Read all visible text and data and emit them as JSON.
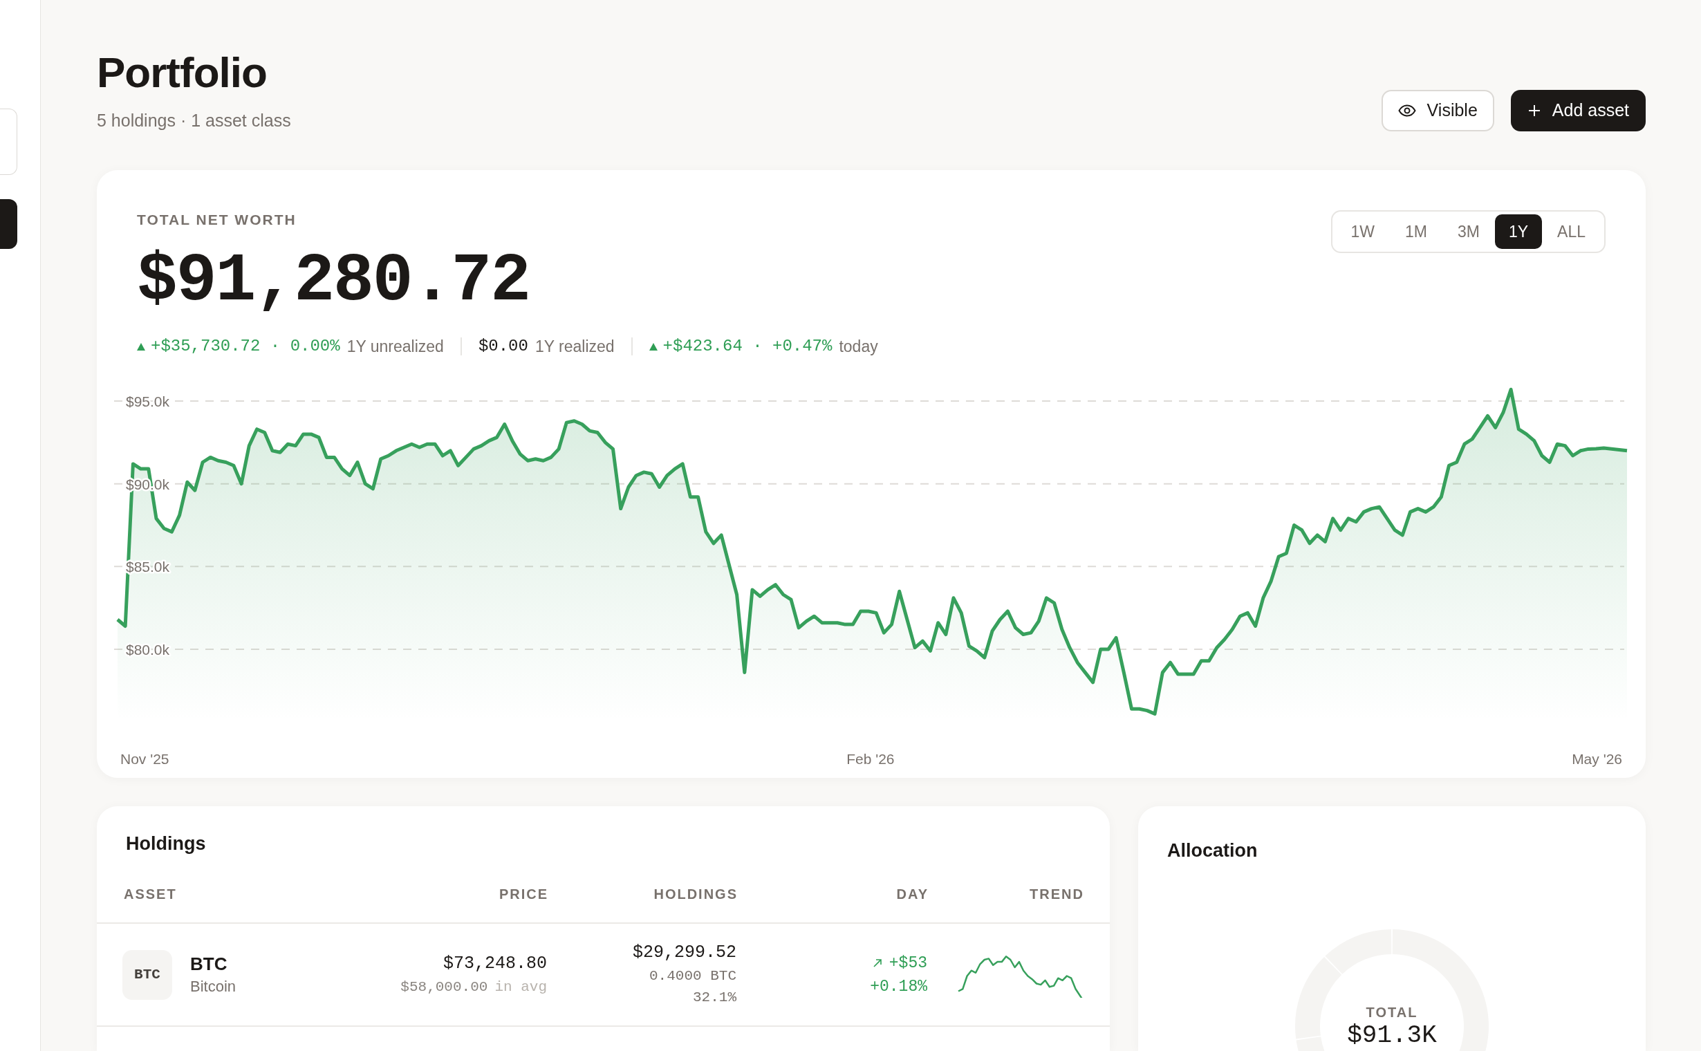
{
  "sidebar": {
    "items": [
      {
        "selected": false
      },
      {
        "selected": true
      }
    ]
  },
  "header": {
    "title": "Portfolio",
    "subtitle": "5 holdings · 1 asset class",
    "actions": [
      {
        "label": "Visible",
        "kind": "secondary"
      },
      {
        "label": "Add asset",
        "kind": "primary"
      }
    ]
  },
  "net_worth": {
    "label": "TOTAL NET WORTH",
    "value": "$91,280.72",
    "ranges": [
      {
        "label": "1W",
        "selected": false
      },
      {
        "label": "1M",
        "selected": false
      },
      {
        "label": "3M",
        "selected": false
      },
      {
        "label": "1Y",
        "selected": true
      },
      {
        "label": "ALL",
        "selected": false
      }
    ],
    "summary": [
      {
        "value": "+$35,730.72 · 0.00%",
        "label": "1Y unrealized",
        "color": "#2f9e55",
        "arrow": true
      },
      {
        "value": "$0.00",
        "label": "1Y realized",
        "color": "#1c1917",
        "arrow": false
      },
      {
        "value": "+$423.64 · +0.47%",
        "label": "today",
        "color": "#2f9e55",
        "arrow": true
      }
    ],
    "chart_data": {
      "type": "area",
      "ylim": [
        72.19,
        108.91
      ],
      "grid": true,
      "yticks": [
        {
          "value": 80,
          "label": "$80.0k"
        },
        {
          "value": 85,
          "label": "$85.0k"
        },
        {
          "value": 90,
          "label": "$90.0k"
        },
        {
          "value": 95,
          "label": "$95.0k"
        }
      ],
      "values": [
        81.8,
        81.4,
        91.2,
        90.9,
        90.9,
        87.9,
        87.3,
        87.1,
        88.1,
        90.1,
        89.6,
        91.3,
        91.6,
        91.4,
        91.3,
        91.1,
        90.0,
        92.3,
        93.3,
        93.1,
        92.0,
        91.9,
        92.4,
        92.3,
        93.0,
        93.0,
        92.8,
        91.6,
        91.6,
        90.9,
        90.5,
        91.3,
        90.0,
        89.7,
        91.5,
        91.7,
        92.0,
        92.2,
        92.4,
        92.2,
        92.4,
        92.4,
        91.7,
        92.0,
        91.1,
        91.6,
        92.1,
        92.3,
        92.6,
        92.8,
        93.6,
        92.6,
        91.8,
        91.4,
        91.5,
        91.4,
        91.6,
        92.1,
        93.7,
        93.8,
        93.6,
        93.2,
        93.1,
        92.5,
        92.1,
        88.5,
        89.8,
        90.5,
        90.7,
        90.6,
        89.8,
        90.5,
        90.9,
        91.2,
        89.2,
        89.2,
        87.1,
        86.4,
        86.9,
        85.1,
        83.3,
        78.6,
        83.6,
        83.2,
        83.6,
        83.9,
        83.3,
        83.0,
        81.3,
        81.7,
        82.0,
        81.6,
        81.6,
        81.6,
        81.5,
        81.5,
        82.3,
        82.3,
        82.2,
        81.0,
        81.5,
        83.5,
        81.8,
        80.1,
        80.5,
        79.9,
        81.6,
        80.9,
        83.1,
        82.2,
        80.2,
        79.9,
        79.5,
        81.1,
        81.8,
        82.3,
        81.3,
        80.9,
        81.0,
        81.7,
        83.1,
        82.8,
        81.2,
        80.1,
        79.2,
        78.6,
        78.0,
        80.0,
        80.0,
        80.7,
        78.6,
        76.4,
        76.4,
        76.3,
        76.1,
        78.6,
        79.2,
        78.5,
        78.5,
        78.5,
        79.3,
        79.3,
        80.1,
        80.6,
        81.2,
        82.0,
        82.2,
        81.4,
        83.1,
        84.1,
        85.6,
        85.8,
        87.5,
        87.2,
        86.4,
        86.9,
        86.5,
        87.9,
        87.2,
        87.9,
        87.7,
        88.3,
        88.5,
        88.6,
        87.9,
        87.2,
        86.9,
        88.3,
        88.5,
        88.3,
        88.6,
        89.2,
        91.1,
        91.3,
        92.4,
        92.7,
        93.4,
        94.1,
        93.4,
        94.3,
        95.7,
        93.3,
        93.0,
        92.6,
        91.7,
        91.3,
        92.4,
        92.3,
        91.7,
        92.0,
        92.1,
        92.12,
        92.16,
        92.11,
        92.05,
        92.0
      ]
    },
    "axis_dates": [
      "Nov '25",
      "Feb '26",
      "May '26"
    ]
  },
  "holdings": {
    "title": "Holdings",
    "columns": [
      "ASSET",
      "PRICE",
      "HOLDINGS",
      "DAY",
      "TREND"
    ],
    "rows": [
      {
        "badge": "BTC",
        "symbol": "BTC",
        "name": "Bitcoin",
        "price": "$73,248.80",
        "avg_cost": "$58,000.00",
        "avg_label": "in avg",
        "value": "$29,299.52",
        "quantity": "0.4000 BTC",
        "weight": "32.1%",
        "day_change": "+$53",
        "day_percent": "+0.18%",
        "color": "#2f9e55",
        "arrow": true
      }
    ]
  },
  "allocation": {
    "title": "Allocation",
    "total_label": "TOTAL",
    "total": "$91.3K"
  }
}
